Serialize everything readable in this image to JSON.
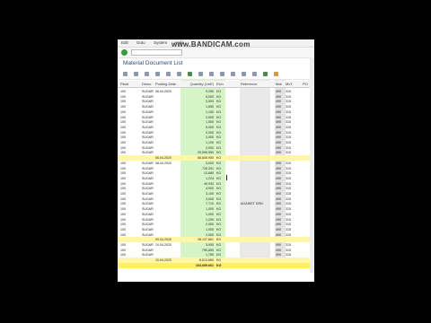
{
  "window": {
    "menu": [
      "Edit",
      "Goto",
      "System",
      "Help"
    ],
    "watermark": "www.BANDICAM.com",
    "title": "Material Document List"
  },
  "grid": {
    "headers": {
      "plant": "Plant",
      "desc": "Descr.",
      "date": "Posting Date",
      "qty": "Quantity (UnE)",
      "uom": "EUn",
      "ref": "Reference",
      "mvt": "Mat",
      "mvt2": "MvT",
      "po": "PO"
    },
    "rows": [
      {
        "plant": "100",
        "desc": "SUGAR",
        "date": "06.04.2020",
        "qty": "9,250",
        "uom": "KG",
        "ref": "",
        "mvt": "490",
        "mvt2": "315",
        "po": ""
      },
      {
        "plant": "100",
        "desc": "SUGAR",
        "date": "",
        "qty": "5,000",
        "uom": "KG",
        "ref": "",
        "mvt": "490",
        "mvt2": "315",
        "po": ""
      },
      {
        "plant": "100",
        "desc": "SUGAR",
        "date": "",
        "qty": "2,500",
        "uom": "KG",
        "ref": "",
        "mvt": "490",
        "mvt2": "315",
        "po": ""
      },
      {
        "plant": "100",
        "desc": "SUGAR",
        "date": "",
        "qty": "1,650",
        "uom": "KG",
        "ref": "",
        "mvt": "490",
        "mvt2": "315",
        "po": ""
      },
      {
        "plant": "100",
        "desc": "SUGAR",
        "date": "",
        "qty": "1,150",
        "uom": "KG",
        "ref": "",
        "mvt": "490",
        "mvt2": "315",
        "po": ""
      },
      {
        "plant": "100",
        "desc": "SUGAR",
        "date": "",
        "qty": "2,000",
        "uom": "KG",
        "ref": "",
        "mvt": "490",
        "mvt2": "315",
        "po": ""
      },
      {
        "plant": "100",
        "desc": "SUGAR",
        "date": "",
        "qty": "1,500",
        "uom": "KG",
        "ref": "",
        "mvt": "490",
        "mvt2": "315",
        "po": ""
      },
      {
        "plant": "100",
        "desc": "SUGAR",
        "date": "",
        "qty": "5,000",
        "uom": "KG",
        "ref": "",
        "mvt": "490",
        "mvt2": "315",
        "po": ""
      },
      {
        "plant": "100",
        "desc": "SUGAR",
        "date": "",
        "qty": "2,000",
        "uom": "KG",
        "ref": "",
        "mvt": "490",
        "mvt2": "315",
        "po": ""
      },
      {
        "plant": "100",
        "desc": "SUGAR",
        "date": "",
        "qty": "2,000",
        "uom": "KG",
        "ref": "",
        "mvt": "490",
        "mvt2": "315",
        "po": ""
      },
      {
        "plant": "100",
        "desc": "SUGAR",
        "date": "",
        "qty": "1,100",
        "uom": "KG",
        "ref": "",
        "mvt": "490",
        "mvt2": "315",
        "po": ""
      },
      {
        "plant": "100",
        "desc": "SUGAR",
        "date": "",
        "qty": "2,000",
        "uom": "KG",
        "ref": "",
        "mvt": "490",
        "mvt2": "315",
        "po": ""
      },
      {
        "plant": "100",
        "desc": "SUGAR",
        "date": "",
        "qty": "29,595.950",
        "uom": "KG",
        "ref": "",
        "mvt": "490",
        "mvt2": "315",
        "po": ""
      },
      {
        "type": "sub",
        "date": "06.04.2020",
        "qty": "66,845.950",
        "uom": "KG"
      },
      {
        "plant": "100",
        "desc": "SUGAR",
        "date": "08.04.2020",
        "qty": "3,000",
        "uom": "KG",
        "ref": "",
        "mvt": "490",
        "mvt2": "315",
        "po": ""
      },
      {
        "plant": "100",
        "desc": "SUGAR",
        "date": "",
        "qty": "726.251",
        "uom": "KG",
        "ref": "",
        "mvt": "490",
        "mvt2": "315",
        "po": ""
      },
      {
        "plant": "100",
        "desc": "SUGAR",
        "date": "",
        "qty": "12,880",
        "uom": "KG",
        "ref": "",
        "mvt": "490",
        "mvt2": "315",
        "po": ""
      },
      {
        "plant": "100",
        "desc": "SUGAR",
        "date": "",
        "qty": "1,224",
        "uom": "KG",
        "ref": "",
        "mvt": "490",
        "mvt2": "315",
        "po": ""
      },
      {
        "plant": "100",
        "desc": "SUGAR",
        "date": "",
        "qty": "49,930",
        "uom": "KG",
        "ref": "",
        "mvt": "490",
        "mvt2": "315",
        "po": ""
      },
      {
        "plant": "100",
        "desc": "SUGAR",
        "date": "",
        "qty": "4,900",
        "uom": "KG",
        "ref": "",
        "mvt": "490",
        "mvt2": "315",
        "po": ""
      },
      {
        "plant": "100",
        "desc": "SUGAR",
        "date": "",
        "qty": "3,100",
        "uom": "KG",
        "ref": "",
        "mvt": "490",
        "mvt2": "315",
        "po": ""
      },
      {
        "plant": "100",
        "desc": "SUGAR",
        "date": "",
        "qty": "3,000",
        "uom": "KG",
        "ref": "",
        "mvt": "490",
        "mvt2": "315",
        "po": ""
      },
      {
        "plant": "100",
        "desc": "SUGAR",
        "date": "",
        "qty": "7,710",
        "uom": "KG",
        "ref": "AGAINST GRN",
        "mvt": "490",
        "mvt2": "315",
        "po": ""
      },
      {
        "plant": "100",
        "desc": "SUGAR",
        "date": "",
        "qty": "1,000",
        "uom": "KG",
        "ref": "",
        "mvt": "490",
        "mvt2": "315",
        "po": ""
      },
      {
        "plant": "100",
        "desc": "SUGAR",
        "date": "",
        "qty": "1,000",
        "uom": "KG",
        "ref": "",
        "mvt": "490",
        "mvt2": "315",
        "po": ""
      },
      {
        "plant": "100",
        "desc": "SUGAR",
        "date": "",
        "qty": "1,200",
        "uom": "KG",
        "ref": "",
        "mvt": "490",
        "mvt2": "315",
        "po": ""
      },
      {
        "plant": "100",
        "desc": "SUGAR",
        "date": "",
        "qty": "2,500",
        "uom": "KG",
        "ref": "",
        "mvt": "490",
        "mvt2": "315",
        "po": ""
      },
      {
        "plant": "100",
        "desc": "SUGAR",
        "date": "",
        "qty": "1,000",
        "uom": "KG",
        "ref": "",
        "mvt": "490",
        "mvt2": "315",
        "po": ""
      },
      {
        "plant": "100",
        "desc": "SUGAR",
        "date": "",
        "qty": "2,000",
        "uom": "KG",
        "ref": "",
        "mvt": "490",
        "mvt2": "315",
        "po": ""
      },
      {
        "type": "sub",
        "date": "09.04.2020",
        "qty": "28,137.861",
        "uom": "KG"
      },
      {
        "plant": "100",
        "desc": "SUGAR",
        "date": "10.04.2020",
        "qty": "3,900",
        "uom": "KG",
        "ref": "",
        "mvt": "490",
        "mvt2": "315",
        "po": ""
      },
      {
        "plant": "100",
        "desc": "SUGAR",
        "date": "",
        "qty": "750,850",
        "uom": "KG",
        "ref": "",
        "mvt": "490",
        "mvt2": "315",
        "po": ""
      },
      {
        "plant": "100",
        "desc": "SUGAR",
        "date": "",
        "qty": "1,750",
        "uom": "KG",
        "ref": "",
        "mvt": "490",
        "mvt2": "315",
        "po": ""
      },
      {
        "type": "sub",
        "date": "10.04.2020",
        "qty": "8,513.850",
        "uom": "KG"
      },
      {
        "type": "total",
        "qty": "103,699.661",
        "uom": "KG"
      }
    ]
  }
}
